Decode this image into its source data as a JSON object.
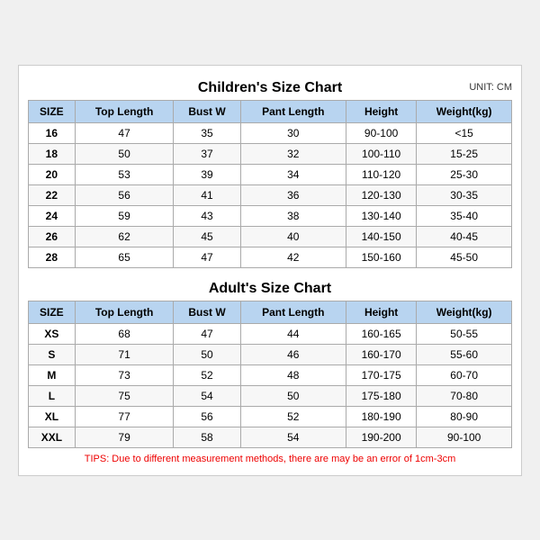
{
  "children_section": {
    "title": "Children's Size Chart",
    "unit": "UNIT: CM",
    "headers": [
      "SIZE",
      "Top Length",
      "Bust W",
      "Pant Length",
      "Height",
      "Weight(kg)"
    ],
    "rows": [
      [
        "16",
        "47",
        "35",
        "30",
        "90-100",
        "<15"
      ],
      [
        "18",
        "50",
        "37",
        "32",
        "100-110",
        "15-25"
      ],
      [
        "20",
        "53",
        "39",
        "34",
        "110-120",
        "25-30"
      ],
      [
        "22",
        "56",
        "41",
        "36",
        "120-130",
        "30-35"
      ],
      [
        "24",
        "59",
        "43",
        "38",
        "130-140",
        "35-40"
      ],
      [
        "26",
        "62",
        "45",
        "40",
        "140-150",
        "40-45"
      ],
      [
        "28",
        "65",
        "47",
        "42",
        "150-160",
        "45-50"
      ]
    ]
  },
  "adults_section": {
    "title": "Adult's Size Chart",
    "headers": [
      "SIZE",
      "Top Length",
      "Bust W",
      "Pant Length",
      "Height",
      "Weight(kg)"
    ],
    "rows": [
      [
        "XS",
        "68",
        "47",
        "44",
        "160-165",
        "50-55"
      ],
      [
        "S",
        "71",
        "50",
        "46",
        "160-170",
        "55-60"
      ],
      [
        "M",
        "73",
        "52",
        "48",
        "170-175",
        "60-70"
      ],
      [
        "L",
        "75",
        "54",
        "50",
        "175-180",
        "70-80"
      ],
      [
        "XL",
        "77",
        "56",
        "52",
        "180-190",
        "80-90"
      ],
      [
        "XXL",
        "79",
        "58",
        "54",
        "190-200",
        "90-100"
      ]
    ]
  },
  "tips": "TIPS: Due to different measurement methods, there are may be an error of 1cm-3cm"
}
